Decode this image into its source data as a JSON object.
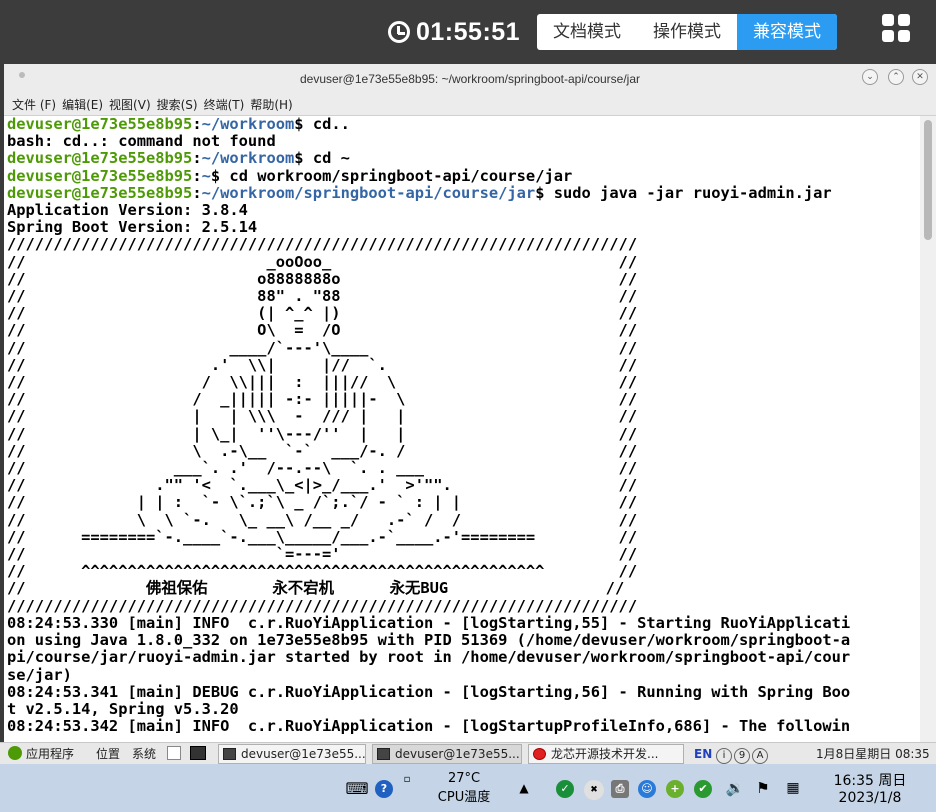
{
  "exam": {
    "timer": "01:55:51",
    "modes": [
      "文档模式",
      "操作模式",
      "兼容模式"
    ],
    "active_mode": "兼容模式"
  },
  "window": {
    "title": "devuser@1e73e55e8b95: ~/workroom/springboot-api/course/jar",
    "menu": [
      "文件 (F)",
      "编辑(E)",
      "视图(V)",
      "搜索(S)",
      "终端(T)",
      "帮助(H)"
    ]
  },
  "terminal": {
    "lines": [
      {
        "user": "devuser@1e73e55e8b95",
        "path": "~/workroom",
        "cmd": " cd.."
      },
      {
        "text": "bash: cd..: command not found"
      },
      {
        "user": "devuser@1e73e55e8b95",
        "path": "~/workroom",
        "cmd": " cd ~"
      },
      {
        "user": "devuser@1e73e55e8b95",
        "path": "~",
        "cmd": " cd workroom/springboot-api/course/jar"
      },
      {
        "user": "devuser@1e73e55e8b95",
        "path": "~/workroom/springboot-api/course/jar",
        "cmd": " sudo java -jar ruoyi-admin.jar"
      },
      {
        "text": "Application Version: 3.8.4"
      },
      {
        "text": "Spring Boot Version: 2.5.14"
      },
      {
        "text": "////////////////////////////////////////////////////////////////////"
      },
      {
        "text": "//                          _ooOoo_                               //"
      },
      {
        "text": "//                         o8888888o                              //"
      },
      {
        "text": "//                         88\" . \"88                              //"
      },
      {
        "text": "//                         (| ^_^ |)                              //"
      },
      {
        "text": "//                         O\\  =  /O                              //"
      },
      {
        "text": "//                      ____/`---'\\____                           //"
      },
      {
        "text": "//                    .'  \\\\|     |//  `.                         //"
      },
      {
        "text": "//                   /  \\\\|||  :  |||//  \\                        //"
      },
      {
        "text": "//                  /  _||||| -:- |||||-  \\                       //"
      },
      {
        "text": "//                  |   | \\\\\\  -  /// |   |                       //"
      },
      {
        "text": "//                  | \\_|  ''\\---/''  |   |                       //"
      },
      {
        "text": "//                  \\  .-\\__  `-`  ___/-. /                       //"
      },
      {
        "text": "//                ___`. .'  /--.--\\  `. . ___                     //"
      },
      {
        "text": "//              .\"\" '<  `.___\\_<|>_/___.'  >'\"\".                  //"
      },
      {
        "text": "//            | | :  `- \\`.;`\\ _ /`;.`/ - ` : | |                 //"
      },
      {
        "text": "//            \\  \\ `-.   \\_ __\\ /__ _/   .-` /  /                 //"
      },
      {
        "text": "//      ========`-.____`-.___\\_____/___.-`____.-'========         //"
      },
      {
        "text": "//                           `=---='                              //"
      },
      {
        "text": "//      ^^^^^^^^^^^^^^^^^^^^^^^^^^^^^^^^^^^^^^^^^^^^^^^^^^        //"
      },
      {
        "text": "//             佛祖保佑       永不宕机      永无BUG                 //"
      },
      {
        "text": "////////////////////////////////////////////////////////////////////"
      },
      {
        "text": "08:24:53.330 [main] INFO  c.r.RuoYiApplication - [logStarting,55] - Starting RuoYiApplicati"
      },
      {
        "text": "on using Java 1.8.0_332 on 1e73e55e8b95 with PID 51369 (/home/devuser/workroom/springboot-a"
      },
      {
        "text": "pi/course/jar/ruoyi-admin.jar started by root in /home/devuser/workroom/springboot-api/cour"
      },
      {
        "text": "se/jar)"
      },
      {
        "text": "08:24:53.341 [main] DEBUG c.r.RuoYiApplication - [logStarting,56] - Running with Spring Boo"
      },
      {
        "text": "t v2.5.14, Spring v5.3.20"
      },
      {
        "text": "08:24:53.342 [main] INFO  c.r.RuoYiApplication - [logStartupProfileInfo,686] - The followin"
      }
    ]
  },
  "linux_panel": {
    "apps": "应用程序",
    "places": "位置",
    "system": "系统",
    "tasks": [
      "devuser@1e73e55...",
      "devuser@1e73e55...",
      "龙芯开源技术开发..."
    ],
    "lang": "EN",
    "tray_circles": [
      "i",
      "9",
      "A"
    ],
    "clock": "1月8日星期日 08:35"
  },
  "win_taskbar": {
    "temp": "27°C",
    "temp_label": "CPU温度",
    "time": "16:35 周日",
    "date": "2023/1/8"
  }
}
